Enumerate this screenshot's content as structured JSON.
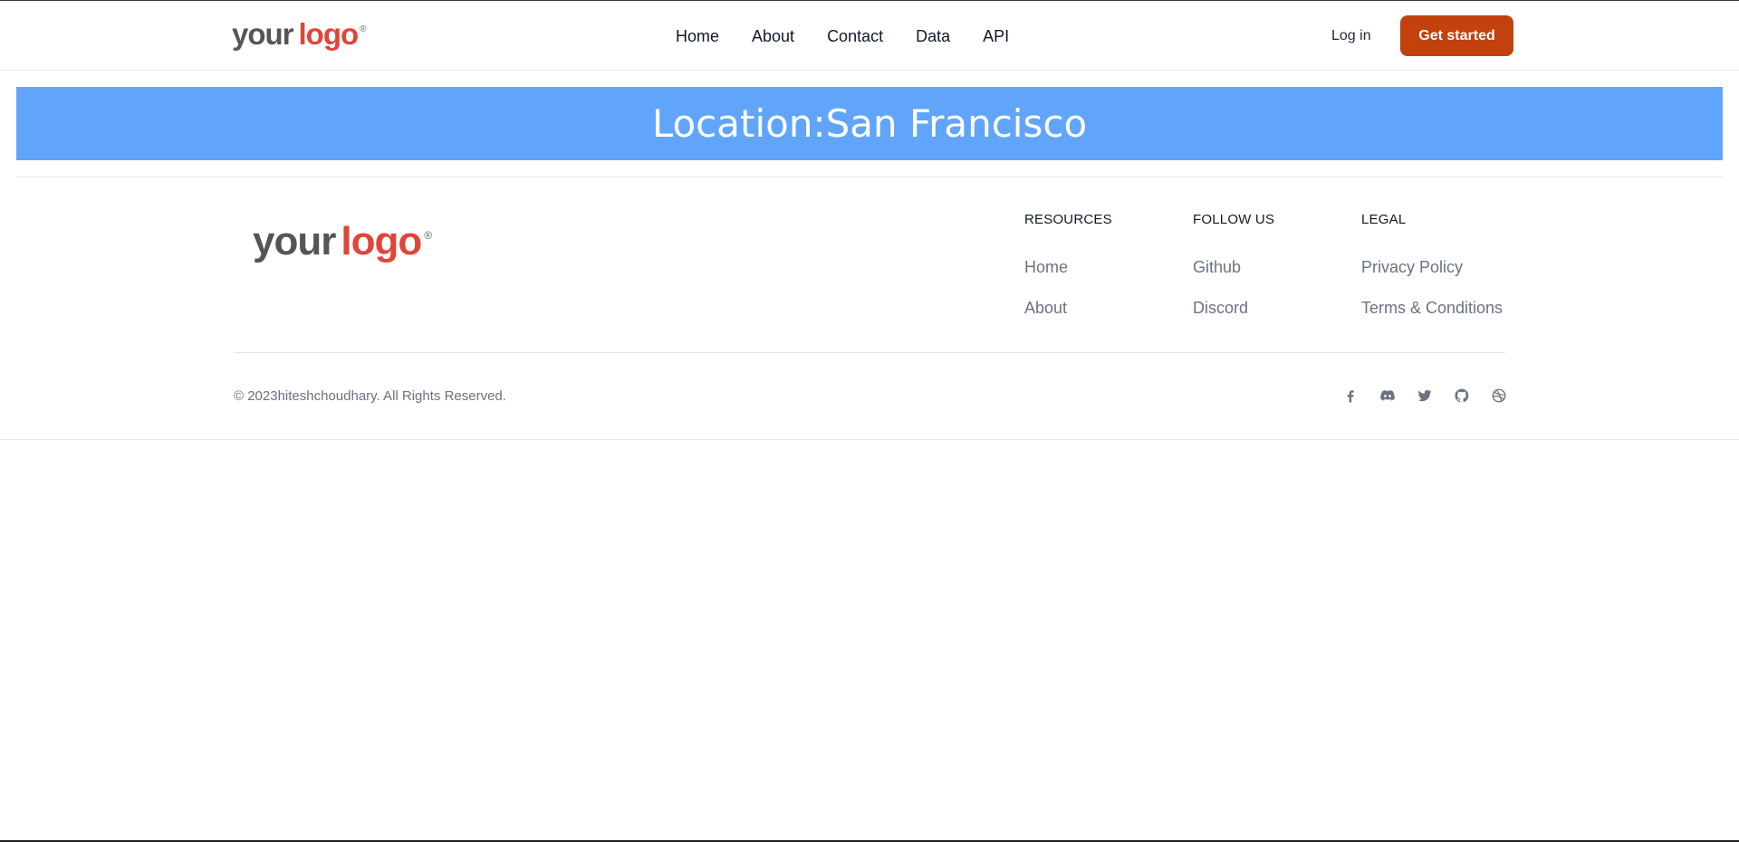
{
  "header": {
    "logo": {
      "word1": "your",
      "word2": "logo",
      "mark": "®"
    },
    "nav": [
      "Home",
      "About",
      "Contact",
      "Data",
      "API"
    ],
    "login_label": "Log in",
    "cta_label": "Get started"
  },
  "banner": {
    "title": "Location:San Francisco"
  },
  "footer": {
    "logo": {
      "word1": "your",
      "word2": "logo",
      "mark": "®"
    },
    "columns": [
      {
        "title": "RESOURCES",
        "links": [
          "Home",
          "About"
        ]
      },
      {
        "title": "FOLLOW US",
        "links": [
          "Github",
          "Discord"
        ]
      },
      {
        "title": "LEGAL",
        "links": [
          "Privacy Policy",
          "Terms & Conditions"
        ]
      }
    ],
    "copyright": "© 2023hiteshchoudhary. All Rights Reserved.",
    "social_icons": [
      "facebook-icon",
      "discord-icon",
      "twitter-icon",
      "github-icon",
      "dribbble-icon"
    ]
  },
  "colors": {
    "brand_accent": "#c2410c",
    "banner_bg": "#60a5fa",
    "logo_red": "#e0453a",
    "logo_gray": "#555555",
    "muted_text": "#6b7280"
  }
}
